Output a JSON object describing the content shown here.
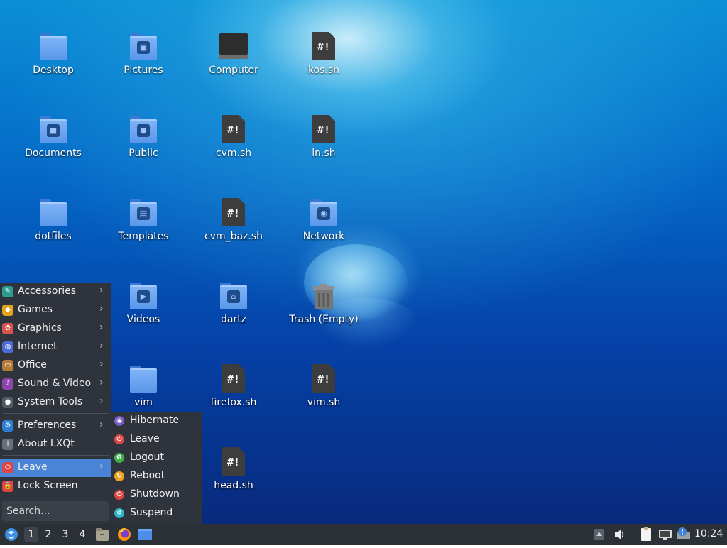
{
  "desktop": {
    "icons": [
      {
        "label": "Desktop",
        "type": "folder",
        "emblem": ""
      },
      {
        "label": "Pictures",
        "type": "folder",
        "emblem": "image-icon"
      },
      {
        "label": "Computer",
        "type": "computer"
      },
      {
        "label": "kos.sh",
        "type": "script"
      },
      {
        "label": "Documents",
        "type": "folder",
        "emblem": "document-icon"
      },
      {
        "label": "Public",
        "type": "folder",
        "emblem": "user-icon"
      },
      {
        "label": "cvm.sh",
        "type": "script"
      },
      {
        "label": "ln.sh",
        "type": "script"
      },
      {
        "label": "dotfiles",
        "type": "folder",
        "emblem": ""
      },
      {
        "label": "Templates",
        "type": "folder",
        "emblem": "template-icon"
      },
      {
        "label": "cvm_baz.sh",
        "type": "script"
      },
      {
        "label": "Network",
        "type": "folder",
        "emblem": "globe-icon"
      },
      {
        "label": "Videos",
        "type": "folder",
        "emblem": "video-icon"
      },
      {
        "label": "dartz",
        "type": "folder",
        "emblem": "home-icon"
      },
      {
        "label": "Trash (Empty)",
        "type": "trash"
      },
      {
        "label": "vim",
        "type": "folder",
        "emblem": ""
      },
      {
        "label": "firefox.sh",
        "type": "script"
      },
      {
        "label": "vim.sh",
        "type": "script"
      },
      {
        "label": "head.sh",
        "type": "script"
      }
    ],
    "script_glyph": "#!"
  },
  "menu": {
    "items": [
      {
        "label": "Accessories",
        "icon": "accessories-icon",
        "submenu": true
      },
      {
        "label": "Games",
        "icon": "gamepad-icon",
        "submenu": true
      },
      {
        "label": "Graphics",
        "icon": "graphics-icon",
        "submenu": true
      },
      {
        "label": "Internet",
        "icon": "internet-icon",
        "submenu": true
      },
      {
        "label": "Office",
        "icon": "briefcase-icon",
        "submenu": true
      },
      {
        "label": "Sound & Video",
        "icon": "multimedia-icon",
        "submenu": true
      },
      {
        "label": "System Tools",
        "icon": "system-tools-icon",
        "submenu": true
      },
      {
        "label": "Preferences",
        "icon": "preferences-icon",
        "submenu": true
      },
      {
        "label": "About LXQt",
        "icon": "info-icon",
        "submenu": false
      },
      {
        "label": "Leave",
        "icon": "power-icon",
        "submenu": true,
        "active": true
      },
      {
        "label": "Lock Screen",
        "icon": "lock-icon",
        "submenu": false
      }
    ],
    "arrow": "›",
    "search_placeholder": "Search...",
    "active_color": "#4a84d6"
  },
  "leave_submenu": {
    "items": [
      {
        "label": "Hibernate",
        "icon": "hibernate-icon",
        "color": "#7b5cc6"
      },
      {
        "label": "Leave",
        "icon": "power-icon",
        "color": "#e04545"
      },
      {
        "label": "Logout",
        "icon": "logout-icon",
        "color": "#3fae4a"
      },
      {
        "label": "Reboot",
        "icon": "reboot-icon",
        "color": "#f0a020"
      },
      {
        "label": "Shutdown",
        "icon": "shutdown-icon",
        "color": "#e04545"
      },
      {
        "label": "Suspend",
        "icon": "suspend-icon",
        "color": "#2eb6c8"
      }
    ]
  },
  "taskbar": {
    "workspaces": [
      "1",
      "2",
      "3",
      "4"
    ],
    "active_workspace": "1",
    "launchers": [
      "file-manager-icon",
      "firefox-icon",
      "show-desktop-icon"
    ],
    "tray": [
      "tray-expand-icon",
      "volume-icon",
      "clipboard-icon",
      "network-icon",
      "update-notifier-icon"
    ],
    "clock": "10:24"
  }
}
